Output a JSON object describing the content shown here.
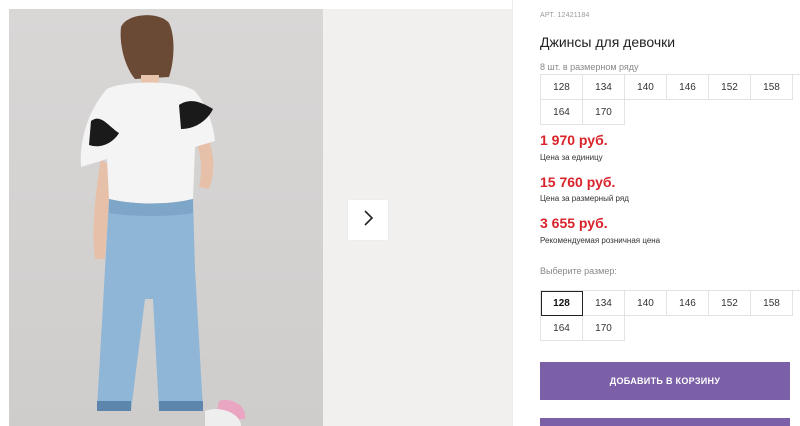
{
  "product": {
    "sku": "АРТ. 12421184",
    "title": "Джинсы для девочки"
  },
  "range": {
    "label": "8 шт. в размерном ряду",
    "sizes": [
      "128",
      "134",
      "140",
      "146",
      "152",
      "158",
      "164",
      "170"
    ]
  },
  "prices": {
    "unit": {
      "value": "1 970 руб.",
      "caption": "Цена за единицу"
    },
    "row": {
      "value": "15 760 руб.",
      "caption": "Цена за размерный ряд"
    },
    "retail": {
      "value": "3 655 руб.",
      "caption": "Рекомендуемая розничная цена"
    }
  },
  "size_picker": {
    "label": "Выберите размер:",
    "sizes": [
      "128",
      "134",
      "140",
      "146",
      "152",
      "158",
      "164",
      "170"
    ],
    "selected": "128"
  },
  "actions": {
    "add_to_cart": "ДОБАВИТЬ В КОРЗИНУ"
  },
  "colors": {
    "price": "#d9232b",
    "accent": "#7b60a8"
  },
  "icons": {
    "gallery_next": "chevron-right-icon"
  }
}
